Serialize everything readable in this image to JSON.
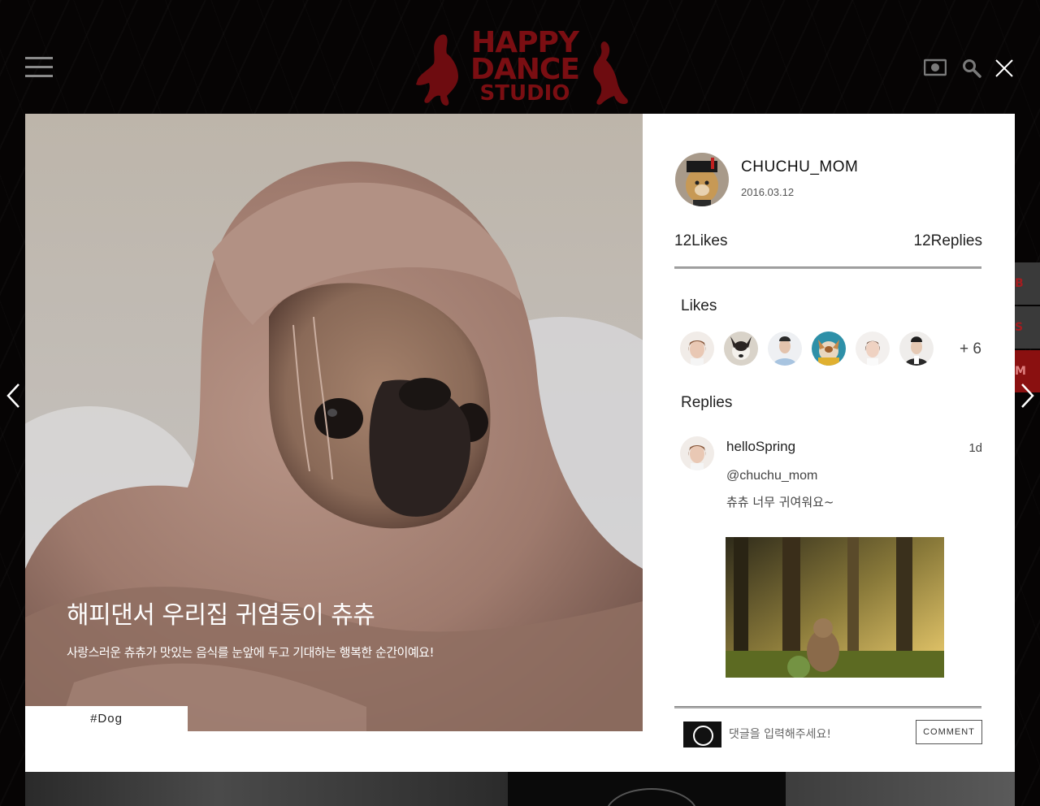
{
  "header": {
    "logo": {
      "line1": "HAPPY",
      "line2": "DANCE",
      "line3": "STUDIO"
    },
    "icons": [
      "menu-icon",
      "camera-icon",
      "search-icon",
      "close-icon"
    ]
  },
  "side_tabs": [
    "B",
    "S",
    "M"
  ],
  "post": {
    "title": "해피댄서 우리집 귀염둥이 츄츄",
    "description": "사랑스러운 츄츄가 맛있는 음식를 눈앞에 두고 기대하는 행복한 순간이예요!",
    "tag": "#Dog",
    "author": "CHUCHU_MOM",
    "date": "2016.03.12",
    "likes_label": "12Likes",
    "replies_label": "12Replies"
  },
  "likes": {
    "title": "Likes",
    "more": "+ 6"
  },
  "replies": {
    "title": "Replies",
    "items": [
      {
        "user": "helloSpring",
        "time": "1d",
        "mention": "@chuchu_mom",
        "text": "츄츄 너무 귀여워요~"
      }
    ]
  },
  "comment": {
    "placeholder": "댓글을 입력해주세요!",
    "button": "COMMENT"
  },
  "colors": {
    "background": "#080606",
    "brand": "#7a0e12",
    "panel": "#ffffff"
  }
}
